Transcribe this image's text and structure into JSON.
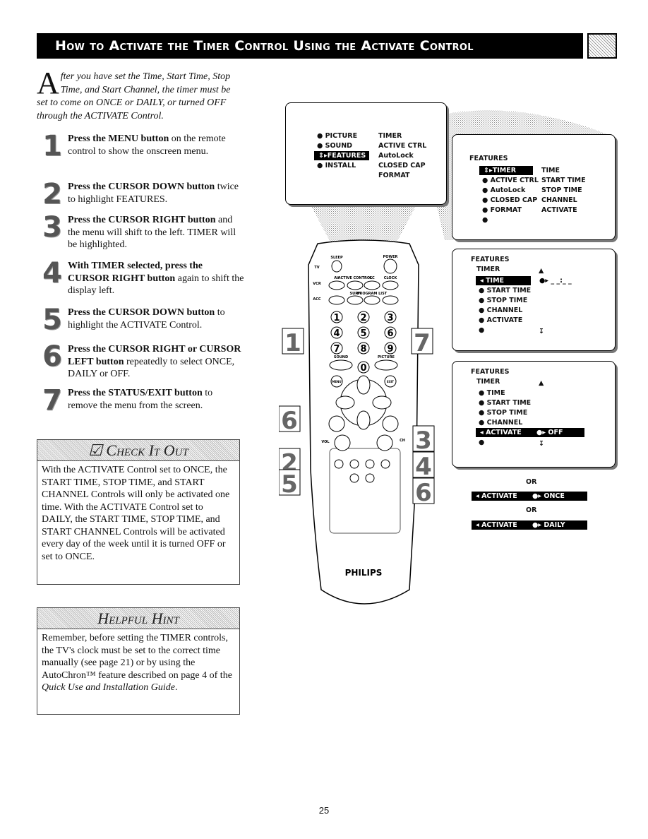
{
  "header": {
    "title": "How to Activate the Timer Control Using the Activate Control",
    "icon": "remote-pad-icon"
  },
  "intro": {
    "drop_cap": "A",
    "text": "fter you have set the Time, Start Time, Stop Time, and Start Channel, the timer must be set to come on ONCE or DAILY, or turned OFF through the ACTIVATE Control."
  },
  "steps": [
    {
      "num": "1",
      "bold": "Press the MENU button",
      "rest": " on the remote control to show the onscreen menu."
    },
    {
      "num": "2",
      "bold": "Press the CURSOR DOWN button",
      "rest": " twice to highlight FEATURES."
    },
    {
      "num": "3",
      "bold": "Press the CURSOR RIGHT button",
      "rest": " and the menu will shift to the left. TIMER will be highlighted."
    },
    {
      "num": "4",
      "bold": "With TIMER selected, press the CURSOR RIGHT button",
      "rest": " again to shift the display left."
    },
    {
      "num": "5",
      "bold": "Press the CURSOR DOWN button",
      "rest": " to highlight the ACTIVATE Control."
    },
    {
      "num": "6",
      "bold": "Press the CURSOR RIGHT or CURSOR LEFT button",
      "rest": " repeatedly to select ONCE, DAILY or OFF."
    },
    {
      "num": "7",
      "bold": "Press the STATUS/EXIT button",
      "rest": " to remove the menu from the screen."
    }
  ],
  "check_it_out": {
    "title": "Check It Out",
    "body": "With the ACTIVATE Control set to ONCE, the START TIME, STOP TIME, and START CHANNEL Controls will only be activated one time. With the ACTIVATE Control set to DAILY, the START TIME, STOP TIME, and START CHANNEL Controls will be activated every day of the week until it is turned OFF or set to ONCE."
  },
  "helpful_hint": {
    "title": "Helpful Hint",
    "body": "Remember, before setting the TIMER controls, the TV's clock must be set to the correct time manually (see page 21) or by using the AutoChron™ feature described on page 4 of the ",
    "italic": "Quick Use and Installation Guide",
    "end": "."
  },
  "menu1": {
    "left": [
      "PICTURE",
      "SOUND",
      "FEATURES",
      "INSTALL"
    ],
    "right": [
      "TIMER",
      "ACTIVE CTRL",
      "AutoLock",
      "CLOSED CAP",
      "FORMAT"
    ],
    "selected": "FEATURES"
  },
  "menu2": {
    "title": "FEATURES",
    "left": [
      "TIMER",
      "ACTIVE CTRL",
      "AutoLock",
      "CLOSED CAP",
      "FORMAT"
    ],
    "right": [
      "TIME",
      "START TIME",
      "STOP TIME",
      "CHANNEL",
      "ACTIVATE"
    ],
    "selected": "TIMER"
  },
  "menu3": {
    "title": "FEATURES",
    "sub": "TIMER",
    "items": [
      "TIME",
      "START TIME",
      "STOP TIME",
      "CHANNEL",
      "ACTIVATE"
    ],
    "selected": "TIME",
    "value": "_ _:_ _"
  },
  "menu4": {
    "title": "FEATURES",
    "sub": "TIMER",
    "items": [
      "TIME",
      "START TIME",
      "STOP TIME",
      "CHANNEL",
      "ACTIVATE"
    ],
    "selected": "ACTIVATE",
    "value": "OFF"
  },
  "options": {
    "or": "OR",
    "label": "ACTIVATE",
    "once": "ONCE",
    "daily": "DAILY"
  },
  "remote": {
    "brand": "PHILIPS",
    "buttons": [
      "SLEEP",
      "POWER",
      "AV",
      "ACTIVE CONTROL",
      "CC",
      "CLOCK",
      "SURF",
      "PROGRAM LIST",
      "MENU",
      "EXIT",
      "SOUND",
      "PICTURE",
      "VOL",
      "CH",
      "TV",
      "VCR",
      "ACC"
    ],
    "digits": [
      "1",
      "2",
      "3",
      "4",
      "5",
      "6",
      "7",
      "8",
      "9",
      "0"
    ],
    "callouts": [
      "1",
      "7",
      "6",
      "3",
      "2",
      "4",
      "5",
      "6"
    ]
  },
  "page_number": "25"
}
